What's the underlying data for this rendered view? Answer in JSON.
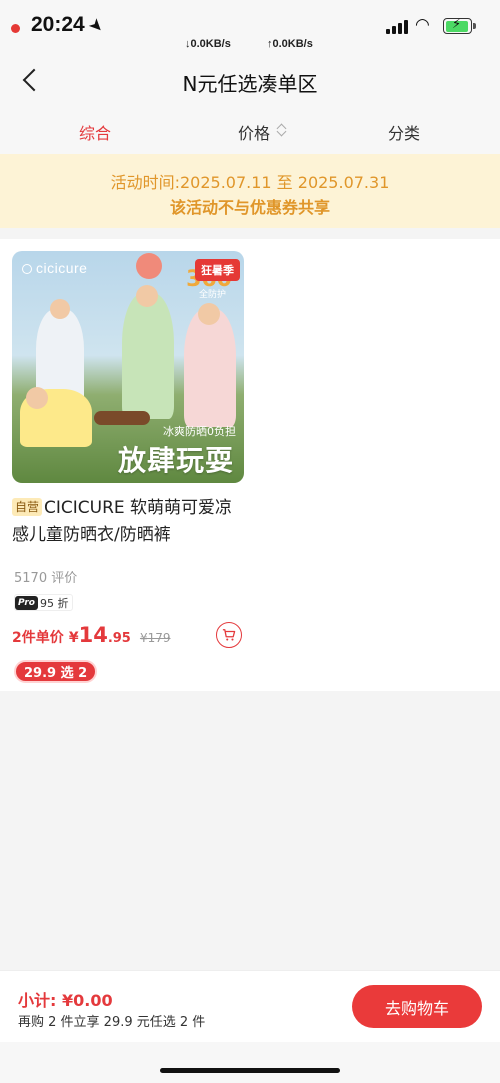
{
  "status_bar": {
    "time": "20:24",
    "net_down": "↓0.0KB/s",
    "net_up": "↑0.0KB/s",
    "icons": [
      "location-arrow-icon",
      "signal-icon",
      "wifi-icon",
      "battery-charging-icon"
    ]
  },
  "nav": {
    "title": "N元任选凑单区",
    "back_icon": "chevron-left-icon"
  },
  "tabs": {
    "items": [
      {
        "label": "综合",
        "active": true
      },
      {
        "label": "价格",
        "active": false
      },
      {
        "label": "分类",
        "active": false
      }
    ]
  },
  "notice": {
    "line1": "活动时间:2025.07.11 至 2025.07.31",
    "line2": "该活动不与优惠券共享"
  },
  "products": [
    {
      "image": {
        "brand": "cicicure",
        "badge": "狂暑季",
        "uv_badge": "360",
        "uv_sub": "全防护",
        "slogan_small": "冰爽防晒0负担",
        "slogan_large": "放肆玩耍"
      },
      "tag": "自营",
      "title": "CICICURE 软萌萌可爱凉感儿童防晒衣/防晒裤",
      "reviews": "5170 评价",
      "pro_tag": "Pro",
      "pro_discount": "95 折",
      "price_label": "2件单价",
      "price_symbol": "¥",
      "price_int": "14",
      "price_dec": ".95",
      "price_original": "¥179",
      "promo": "29.9 选 2"
    }
  ],
  "bottom_bar": {
    "subtotal": "小计: ¥0.00",
    "hint": "再购 2 件立享 29.9 元任选 2 件",
    "go_cart": "去购物车"
  },
  "colors": {
    "accent": "#e4393c",
    "notice_bg": "#fdf3d6",
    "notice_text": "#e0962a"
  }
}
